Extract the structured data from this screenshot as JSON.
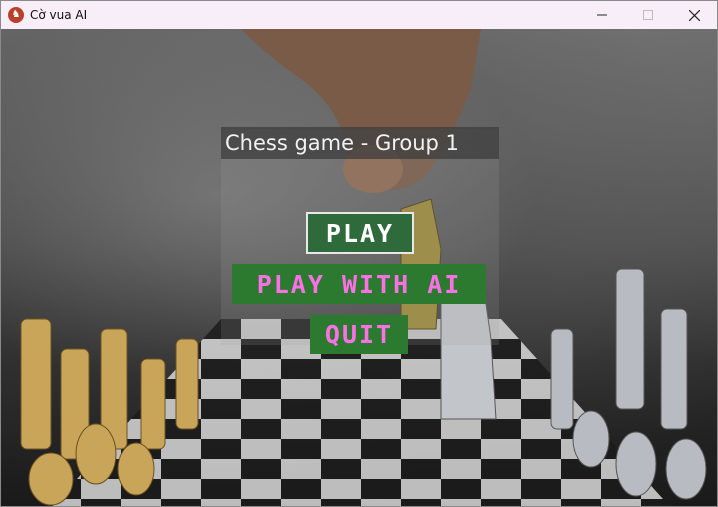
{
  "window": {
    "title": "Cờ vua AI",
    "icon": "chess-app-icon",
    "controls": {
      "minimize_icon": "minimize-icon",
      "maximize_icon": "maximize-icon",
      "close_icon": "close-icon"
    }
  },
  "menu": {
    "title": "Chess game - Group 1",
    "play_label": "PLAY",
    "play_ai_label": "PLAY WITH AI",
    "quit_label": "QUIT"
  },
  "colors": {
    "play_bg": "#2f6b3a",
    "button_bg": "#2c7a30",
    "button_text": "#ff6fe6",
    "titlebar_bg": "#f7eef8"
  }
}
